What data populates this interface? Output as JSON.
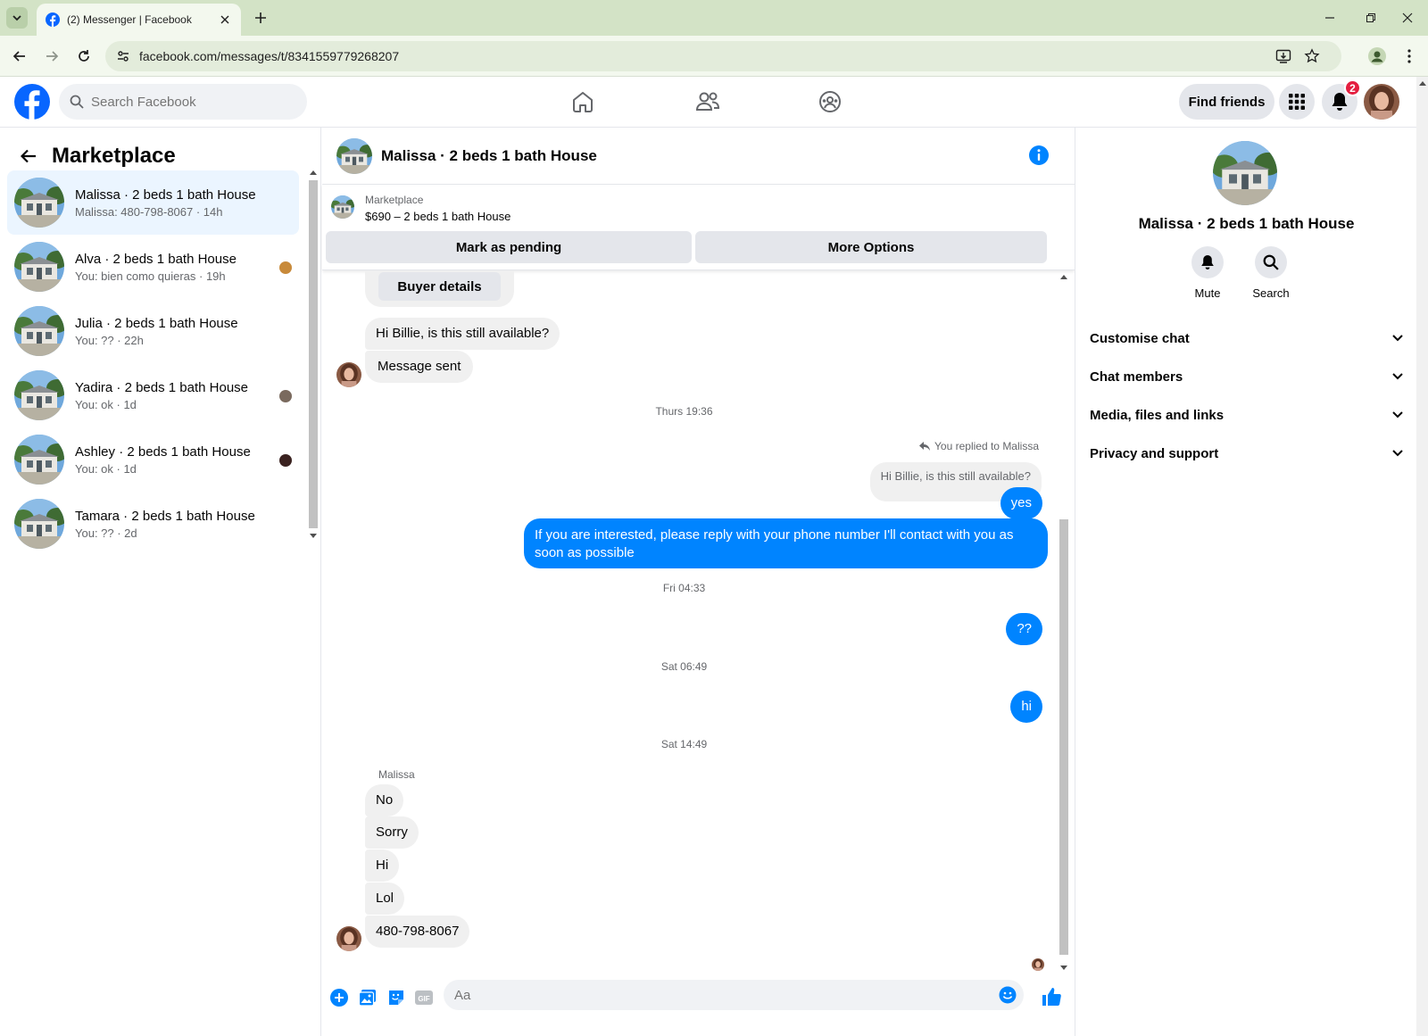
{
  "browser": {
    "tab_title": "(2) Messenger | Facebook",
    "url": "facebook.com/messages/t/8341559779268207"
  },
  "facebook": {
    "search_placeholder": "Search Facebook",
    "find_friends": "Find friends",
    "notification_count": "2"
  },
  "sidebar": {
    "heading": "Marketplace",
    "conversations": [
      {
        "name": "Malissa · 2 beds 1 bath House",
        "preview": "Malissa: 480-798-8067 · 14h",
        "active": true
      },
      {
        "name": "Alva · 2 beds 1 bath House",
        "preview": "You: bien como quieras · 19h"
      },
      {
        "name": "Julia · 2 beds 1 bath House",
        "preview": "You: ?? · 22h"
      },
      {
        "name": "Yadira · 2 beds 1 bath House",
        "preview": "You: ok · 1d"
      },
      {
        "name": "Ashley · 2 beds 1 bath House",
        "preview": "You: ok · 1d"
      },
      {
        "name": "Tamara · 2 beds 1 bath House",
        "preview": "You: ?? · 2d"
      }
    ]
  },
  "chat": {
    "title": "Malissa · 2 beds 1 bath House",
    "marketplace_label": "Marketplace",
    "listing": "$690 – 2 beds 1 bath House",
    "mark_pending": "Mark as pending",
    "more_options": "More Options",
    "buyer_details": "Buyer details",
    "msg_still_available": "Hi Billie, is this still available?",
    "msg_sent": "Message sent",
    "stamp1": "Thurs 19:36",
    "replied_to": "You replied to Malissa",
    "quoted": "Hi Billie, is this still available?",
    "out_yes": "yes",
    "out_long_1": "If you are interested, please reply with your phone number  I'll contact with you as",
    "out_long_2": "soon as possible",
    "stamp2": "Fri 04:33",
    "out_qq": "??",
    "stamp3": "Sat 06:49",
    "out_hi": "hi",
    "stamp4": "Sat 14:49",
    "sender_name": "Malissa",
    "in_no": "No",
    "in_sorry": "Sorry",
    "in_hi": "Hi",
    "in_lol": "Lol",
    "in_phone": "480-798-8067",
    "composer_placeholder": "Aa"
  },
  "info_panel": {
    "name": "Malissa · 2 beds 1 bath House",
    "mute": "Mute",
    "search": "Search",
    "sections": [
      "Customise chat",
      "Chat members",
      "Media, files and links",
      "Privacy and support"
    ]
  },
  "colors": {
    "messenger_blue": "#0084ff",
    "facebook_blue": "#0866ff",
    "notification_red": "#e41e3f"
  }
}
